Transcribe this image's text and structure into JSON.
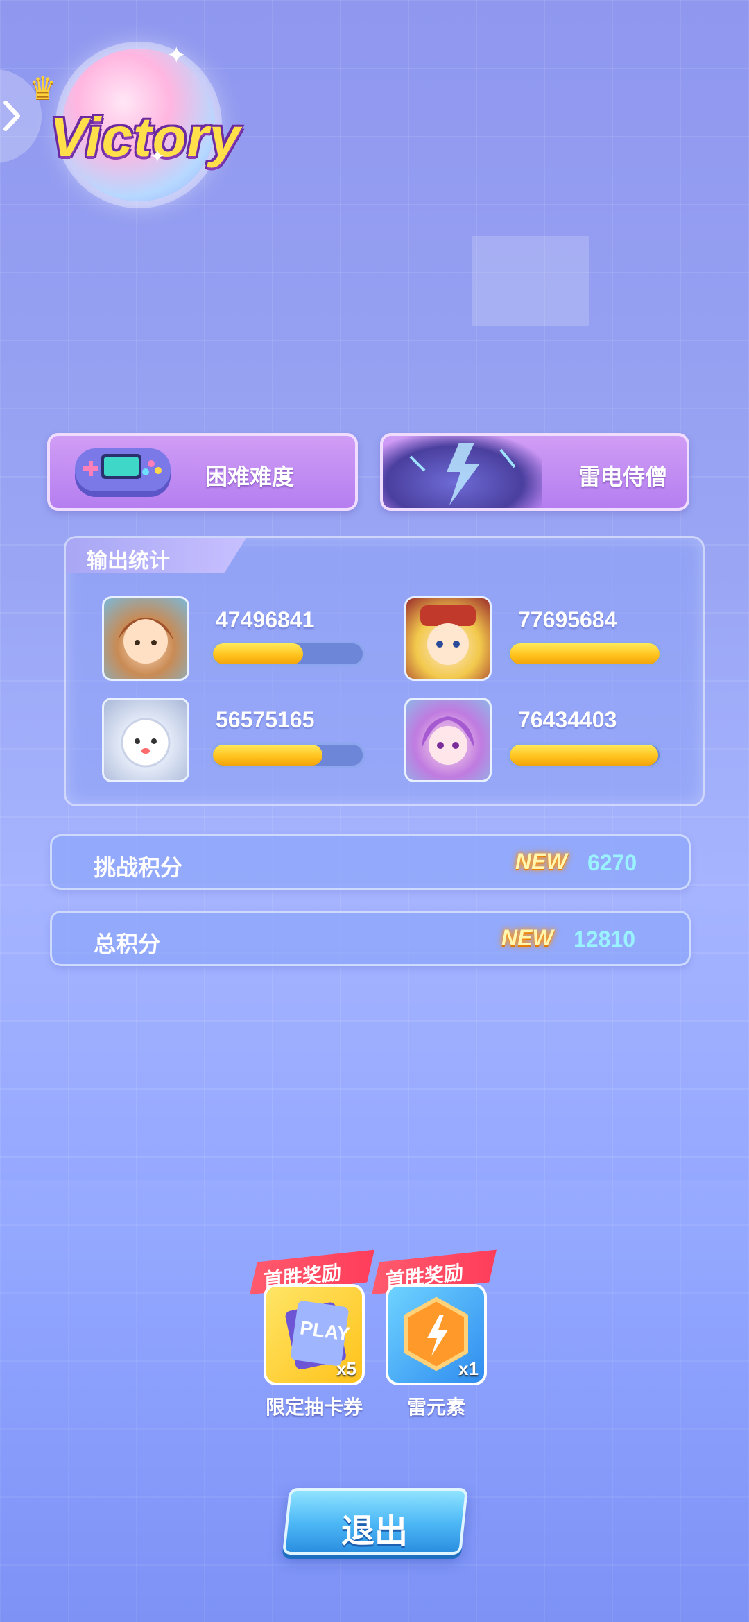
{
  "victory": {
    "title": "Victory"
  },
  "cards": {
    "difficulty": "困难难度",
    "boss": "雷电侍僧"
  },
  "stats": {
    "title": "输出统计",
    "heroes": [
      {
        "name": "hero-1",
        "score": "47496841",
        "progress": 0.6
      },
      {
        "name": "hero-2",
        "score": "77695684",
        "progress": 1.0
      },
      {
        "name": "hero-3",
        "score": "56575165",
        "progress": 0.73
      },
      {
        "name": "hero-4",
        "score": "76434403",
        "progress": 0.99
      }
    ]
  },
  "scores": {
    "challenge_label": "挑战积分",
    "challenge_new": "NEW",
    "challenge_value": "6270",
    "total_label": "总积分",
    "total_new": "NEW",
    "total_value": "12810"
  },
  "rewards": [
    {
      "ribbon": "首胜奖励",
      "name": "限定抽卡券",
      "qty": "x5",
      "icon": "play-ticket-icon"
    },
    {
      "ribbon": "首胜奖励",
      "name": "雷元素",
      "qty": "x1",
      "icon": "thunder-element-icon"
    }
  ],
  "exit_label": "退出",
  "colors": {
    "bar_fill": "#ffc01a",
    "score_value": "#9bf2ff",
    "new_badge": "#fff6b0"
  }
}
